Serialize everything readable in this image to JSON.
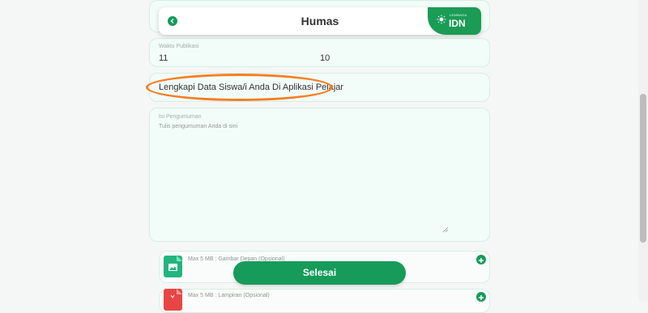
{
  "header": {
    "title": "Humas",
    "brand_small": "LEMBAGA",
    "brand_name": "IDN"
  },
  "publication": {
    "label": "Waktu Publikasi",
    "hour": "11",
    "minute": "10"
  },
  "notice": {
    "text": "Lengkapi Data Siswa/i Anda Di Aplikasi Pelajar"
  },
  "content": {
    "label": "Isi Pengumuman",
    "placeholder": "Tulis pengumuman Anda di sini"
  },
  "uploads": [
    {
      "text": "Max 5 MB : Gambar Depan (Opsional)"
    },
    {
      "text": "Max 5 MB : Lampiran (Opsional)"
    }
  ],
  "submit": {
    "label": "Selesai"
  },
  "colors": {
    "primary": "#169b5a",
    "highlight": "#f57e22",
    "field_bg": "#f2fcf8"
  }
}
